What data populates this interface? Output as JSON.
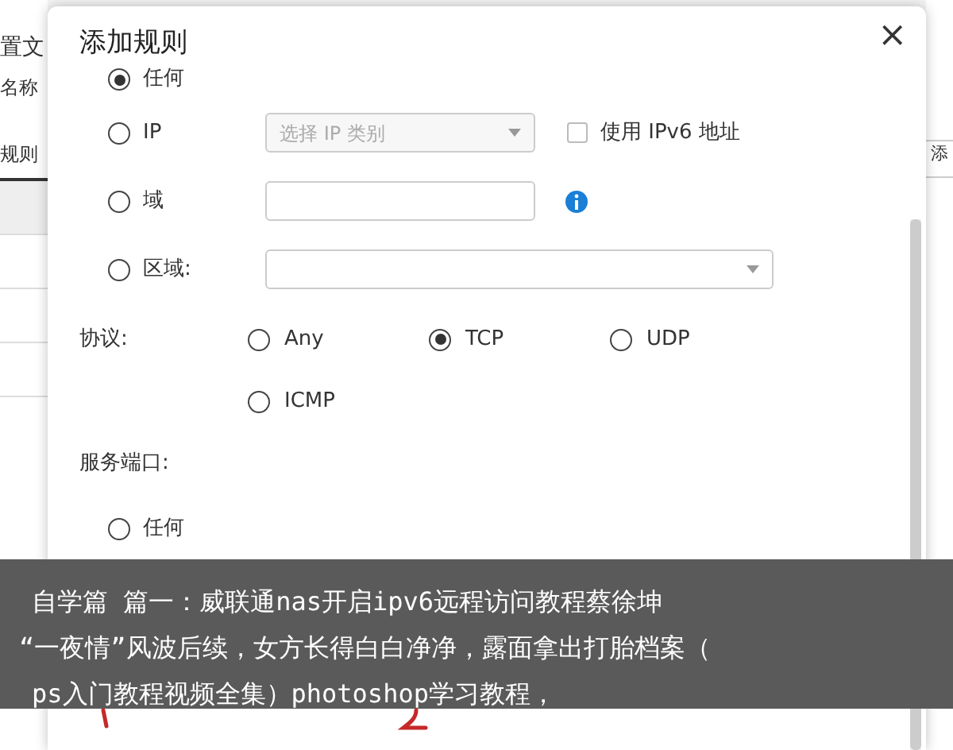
{
  "background": {
    "title": "置文",
    "name_label": "名称",
    "tab": "规则",
    "right_tab": "添"
  },
  "dialog": {
    "title": "添加规则",
    "close": "×",
    "source_options": [
      {
        "kind": "plain",
        "label": "任何",
        "selected": true
      },
      {
        "kind": "select",
        "label": "IP",
        "selected": false,
        "placeholder": "选择 IP 类别",
        "checkbox": {
          "label": "使用 IPv6 地址",
          "checked": false
        }
      },
      {
        "kind": "input",
        "label": "域",
        "selected": false
      },
      {
        "kind": "wide_select",
        "label": "区域:",
        "selected": false
      }
    ],
    "protocol": {
      "label": "协议:",
      "options": [
        {
          "label": "Any",
          "selected": false
        },
        {
          "label": "TCP",
          "selected": true
        },
        {
          "label": "UDP",
          "selected": false
        },
        {
          "label": "ICMP",
          "selected": false
        }
      ]
    },
    "port": {
      "label": "服务端口:",
      "options": [
        {
          "label": "任何",
          "selected": false
        }
      ]
    }
  },
  "caption": {
    "lines": [
      "自学篇 篇一：威联通nas开启ipv6远程访问教程蔡徐坤",
      "“一夜情”风波后续，女方长得白白净净，露面拿出打胎档案（",
      "ps入门教程视频全集）photoshop学习教程，"
    ]
  }
}
